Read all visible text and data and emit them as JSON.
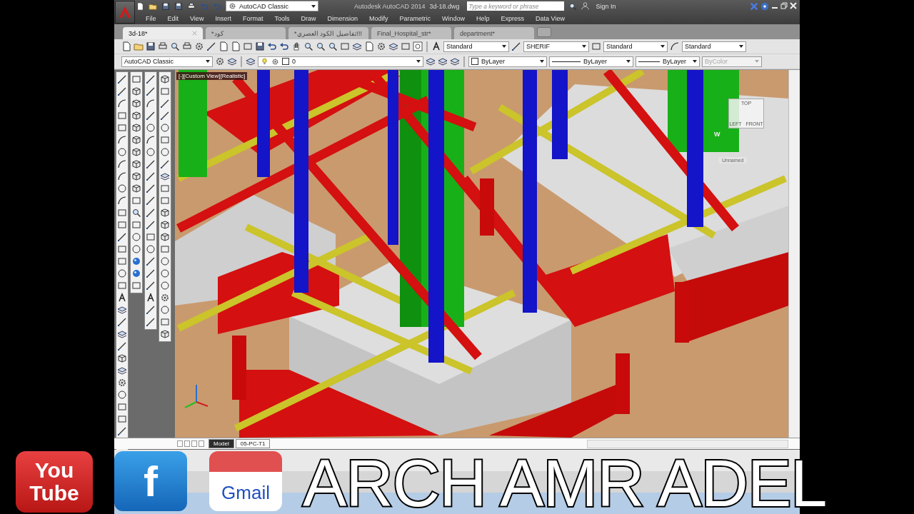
{
  "title_bar": {
    "workspace": "AutoCAD Classic",
    "title": "Autodesk AutoCAD 2014",
    "filename": "3d-18.dwg",
    "search": {
      "placeholder": "Type a keyword or phrase"
    },
    "sign_in": "Sign In"
  },
  "menu_bar": [
    "File",
    "Edit",
    "View",
    "Insert",
    "Format",
    "Tools",
    "Draw",
    "Dimension",
    "Modify",
    "Parametric",
    "Window",
    "Help",
    "Express",
    "Data View"
  ],
  "document_tabs": [
    {
      "label": "3d-18*",
      "selected": true
    },
    {
      "label": "كود*",
      "selected": false
    },
    {
      "label": "!!!تفاصيل الكود العصري*",
      "selected": false
    },
    {
      "label": "Final_Hospital_str*",
      "selected": false
    },
    {
      "label": "department*",
      "selected": false
    }
  ],
  "styles_toolbar": {
    "text_style": "Standard",
    "dimension_style": "SHERIF",
    "table_style": "Standard",
    "multileader_style": "Standard"
  },
  "layers_toolbar": {
    "workspace": "AutoCAD Classic",
    "layer": "0",
    "color_setting": "ByLayer",
    "linetype": "ByLayer",
    "lineweight": "ByLayer",
    "plot_style": {
      "value": "ByColor",
      "disabled": true
    }
  },
  "viewport": {
    "label": "[-][Custom View][Realistic]",
    "viewcube": {
      "top": "TOP",
      "left": "LEFT",
      "front": "FRONT",
      "compass": "W"
    },
    "ucs_name": "Unnamed"
  },
  "layout_tabs": [
    {
      "label": "Model",
      "selected": true
    },
    {
      "label": "05-PC-T1",
      "selected": false
    }
  ],
  "banner": {
    "text": "ARCH AMR ADEL",
    "youtube": [
      "You",
      "Tube"
    ],
    "facebook": "f",
    "gmail": "Gmail"
  }
}
